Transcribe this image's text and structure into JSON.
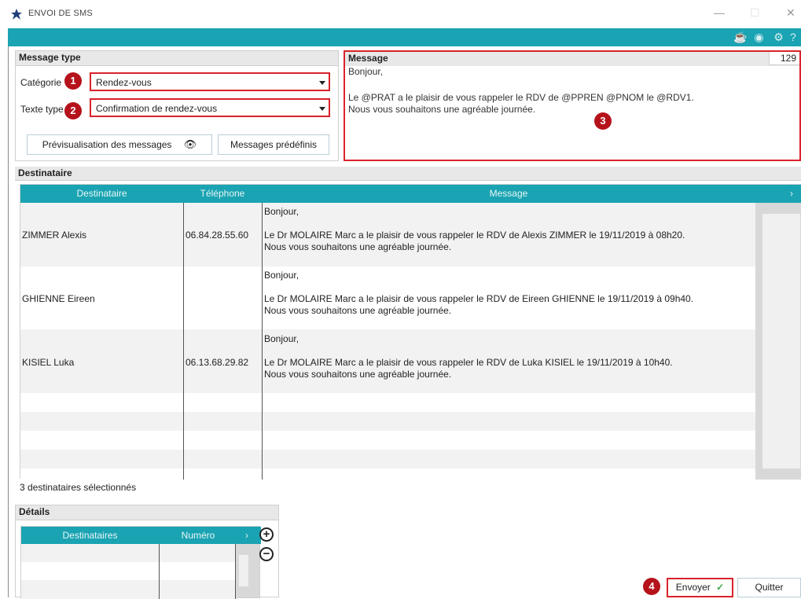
{
  "window": {
    "title": "ENVOI DE SMS"
  },
  "message_type": {
    "header": "Message type",
    "categorie_label": "Catégorie",
    "categorie_value": "Rendez-vous",
    "texte_type_label": "Texte type",
    "texte_type_value": "Confirmation de rendez-vous",
    "preview_button": "Prévisualisation des messages",
    "predefined_button": "Messages prédéfinis"
  },
  "message": {
    "header": "Message",
    "char_count": "129",
    "lines": [
      "Bonjour,",
      "Le @PRAT a le plaisir de vous rappeler le RDV de @PPREN @PNOM le @RDV1.",
      "Nous vous souhaitons une agréable journée."
    ]
  },
  "badges": [
    "1",
    "2",
    "3",
    "4"
  ],
  "recipients": {
    "header": "Destinataire",
    "columns": [
      "Destinataire",
      "Téléphone",
      "Message"
    ],
    "rows": [
      {
        "name": "ZIMMER Alexis",
        "phone": "06.84.28.55.60",
        "msg": [
          "Bonjour,",
          "Le Dr MOLAIRE Marc a le plaisir de vous rappeler le RDV de Alexis ZIMMER le 19/11/2019 à 08h20.",
          "Nous vous souhaitons une agréable journée."
        ]
      },
      {
        "name": "GHIENNE Eireen",
        "phone": "",
        "msg": [
          "Bonjour,",
          "Le Dr MOLAIRE Marc a le plaisir de vous rappeler le RDV de Eireen GHIENNE le 19/11/2019 à 09h40.",
          "Nous vous souhaitons une agréable journée."
        ]
      },
      {
        "name": "KISIEL Luka",
        "phone": "06.13.68.29.82",
        "msg": [
          "Bonjour,",
          "Le Dr MOLAIRE Marc a le plaisir de vous rappeler le RDV de Luka KISIEL le 19/11/2019 à 10h40.",
          "Nous vous souhaitons une agréable journée."
        ]
      }
    ],
    "count_text": "3 destinataires sélectionnés"
  },
  "details": {
    "header": "Détails",
    "columns": [
      "Destinataires",
      "Numéro"
    ]
  },
  "actions": {
    "send": "Envoyer",
    "quit": "Quitter"
  },
  "icons": {
    "window": "star-icon",
    "toolbar": [
      "coffee-icon",
      "user-icon",
      "gear-icon",
      "help-icon"
    ],
    "preview": "eye-icon",
    "send": "checkmark-icon",
    "details_add": "plus-icon",
    "details_remove": "minus-icon"
  },
  "colors": {
    "accent": "#1aa3b2",
    "highlight": "#d9232b",
    "badge": "#b5121b"
  }
}
